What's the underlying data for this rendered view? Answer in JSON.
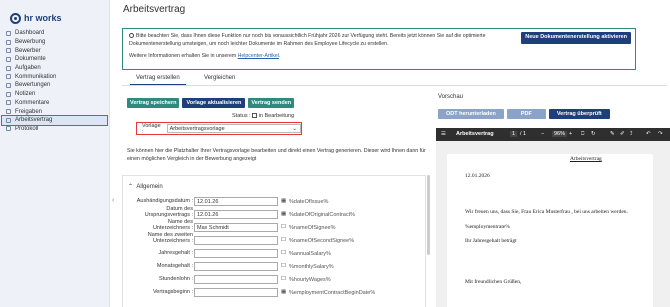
{
  "app": {
    "logo": "hr works"
  },
  "sidebar": {
    "items": [
      {
        "label": "Dashboard"
      },
      {
        "label": "Bewerbung"
      },
      {
        "label": "Bewerber"
      },
      {
        "label": "Dokumente"
      },
      {
        "label": "Aufgaben"
      },
      {
        "label": "Kommunikation"
      },
      {
        "label": "Bewertungen"
      },
      {
        "label": "Notizen"
      },
      {
        "label": "Kommentare"
      },
      {
        "label": "Freigaben"
      },
      {
        "label": "Arbeitsvertrag"
      },
      {
        "label": "Protokoll"
      }
    ],
    "active": "Arbeitsvertrag"
  },
  "page": {
    "title": "Arbeitsvertrag"
  },
  "banner": {
    "message": "Bitte beachten Sie, dass Ihnen diese Funktion nur noch bis voraussichtlich Frühjahr 2026 zur Verfügung steht. Bereits jetzt können Sie auf die optimierte Dokumentenerstellung umsteigen, um noch leichter Dokumente im Rahmen des Employee Lifecycle zu erstellen.",
    "more_prefix": "Weitere Informationen erhalten Sie in unserem",
    "more_link": "Helpcenter-Artikel",
    "more_suffix": ".",
    "button": "Neue Dokumentenerstellung aktivieren"
  },
  "tabs": [
    {
      "label": "Vertrag erstellen",
      "active": true
    },
    {
      "label": "Vergleichen",
      "active": false
    }
  ],
  "actions": {
    "save": "Vertrag speichern",
    "update": "Vorlage aktualisieren",
    "send": "Vertrag senden"
  },
  "status": {
    "label": "Status :",
    "value": "in Bearbeitung"
  },
  "template": {
    "label": "Vorlage :",
    "value": "Arbeitsvertragsvorlage"
  },
  "explanation": "Sie können hier die Platzhalter Ihrer Vertragsvorlage bearbeiten und direkt einen Vertrag generieren. Dieser wird Ihnen dann für einen möglichen Vergleich in der Bewerbung angezeigt",
  "form": {
    "section": "Allgemein",
    "fields": [
      {
        "label": [
          "Aushändigungsdatum :"
        ],
        "value": "12.01.26",
        "placeholder_name": "%dateOfIssue%",
        "calendar": true
      },
      {
        "label": [
          "Datum des",
          "Ursprungsvertrags :"
        ],
        "value": "12.01.26",
        "placeholder_name": "%dateOfOriginalContract%",
        "calendar": true
      },
      {
        "label": [
          "Name des",
          "Unterzeichners :"
        ],
        "value": "Max Schmidt",
        "placeholder_name": "%nameOfSignee%",
        "calendar": false
      },
      {
        "label": [
          "Name des zweiten",
          "Unterzeichners :"
        ],
        "value": "",
        "placeholder_name": "%nameOfSecondSignee%",
        "calendar": false
      },
      {
        "label": [
          "Jahresgehalt :"
        ],
        "value": "",
        "placeholder_name": "%annualSalary%",
        "calendar": false
      },
      {
        "label": [
          "Monatsgehalt :"
        ],
        "value": "",
        "placeholder_name": "%monthlySalary%",
        "calendar": false
      },
      {
        "label": [
          "Stundenlohn :"
        ],
        "value": "",
        "placeholder_name": "%hourlyWages%",
        "calendar": false
      },
      {
        "label": [
          "Vertragsbeginn :"
        ],
        "value": "",
        "placeholder_name": "%employmentContractBeginDate%",
        "calendar": true
      }
    ]
  },
  "preview": {
    "label": "Vorschau",
    "download": "ODT herunterladen",
    "pdf": "PDF",
    "check": "Vertrag überprüft",
    "pdf_title": "Arbeitsvertrag",
    "page_current": "1",
    "page_total": "/ 1",
    "zoom": "96%",
    "doc": {
      "heading": "Arbeitsvertrag",
      "date": "12.01.2026",
      "line1": "Wir freuen uns, dass Sie, Frau Erica Musterfrau , bei uns arbeiten werden.",
      "line2": "%employmentrate%",
      "line3": "Ihr Jahresgehalt beträgt",
      "line4": "Mit freundlichen Grüßen,"
    }
  }
}
